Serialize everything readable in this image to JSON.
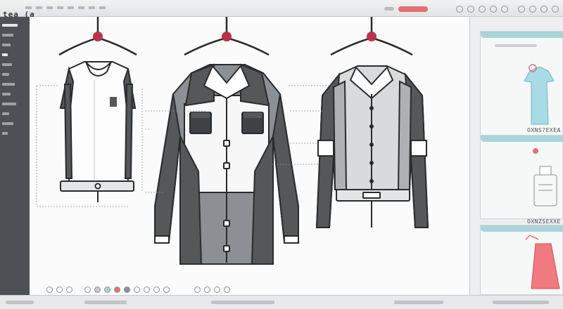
{
  "app": {
    "title": "tea (a"
  },
  "right_panel": {
    "cards": [
      {
        "label": ""
      },
      {
        "label": "OXNS?EXEA"
      },
      {
        "label": "OXNZSEXXE"
      }
    ]
  },
  "colors": {
    "accent_red": "#b8334a",
    "panel_teal": "#a9d5d9",
    "swatch_coral": "#e46f77",
    "shirt_blue": "#a8dbe3",
    "garment_dark": "#555759",
    "garment_mid": "#8c8f93",
    "sidebar": "#4d5054"
  },
  "icons": {
    "hangers": [
      "hanger-icon",
      "hanger-icon",
      "hanger-icon"
    ],
    "bottom_tools": [
      "pointer-icon",
      "crop-icon",
      "pen-icon",
      "brush-icon",
      "color-swatch-icon",
      "palette-icon",
      "fill-icon",
      "layers-icon",
      "zoom-icon",
      "grid-icon",
      "eye-icon",
      "settings-icon"
    ]
  }
}
